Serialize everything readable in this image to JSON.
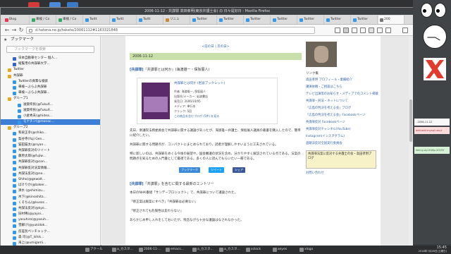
{
  "window": {
    "title": "2006-11-12 - 共謀罪 高田孝明(東京弁護士会) の 日々是好日 - Mozilla Firefox"
  },
  "tabs": [
    {
      "label": "Blog",
      "color": "#e35"
    },
    {
      "label": "車検 / Co",
      "color": "#3a6"
    },
    {
      "label": "車検 / Co",
      "color": "#3a6"
    },
    {
      "label": "Twitt",
      "color": "#39e"
    },
    {
      "label": "Twitt",
      "color": "#39e"
    },
    {
      "label": "Twitt",
      "color": "#39e"
    },
    {
      "label": "リニュ",
      "color": "#c83"
    },
    {
      "label": "Twitter",
      "color": "#39e"
    },
    {
      "label": "Twitter",
      "color": "#39e"
    },
    {
      "label": "Twitter",
      "color": "#39e"
    },
    {
      "label": "Twitter",
      "color": "#39e"
    },
    {
      "label": "Twitter",
      "color": "#39e"
    },
    {
      "label": "Twitter",
      "color": "#39e"
    },
    {
      "label": "Twitter",
      "color": "#39e"
    },
    {
      "label": "200",
      "color": "#777"
    }
  ],
  "nav": {
    "url": "d.hatena.ne.jp/takata/20061112#1163321848"
  },
  "sidebar": {
    "header": "ブックマーク",
    "search_placeholder": "ブックマークを検索",
    "items": [
      {
        "label": "日本自動車センター 個人...",
        "indent": 1,
        "color": "#36c"
      },
      {
        "label": "縦覧用の共謀罪大学...",
        "indent": 1,
        "color": "#36c"
      },
      {
        "label": "Twitter",
        "indent": 0,
        "color": "#e9a820"
      },
      {
        "label": "共謀罪",
        "indent": 0,
        "color": "#e9a820"
      },
      {
        "label": "Twitterの真摯な検索",
        "indent": 1,
        "color": "#39e"
      },
      {
        "label": "車検ーぶらぶ共謀罪",
        "indent": 1,
        "color": "#39e"
      },
      {
        "label": "車検ーぶらぶ共謀罪...",
        "indent": 1,
        "color": "#39e"
      },
      {
        "label": "グループ1",
        "indent": 0,
        "color": "#e9a820"
      },
      {
        "label": "滋賀県民(@FukuX...",
        "indent": 2,
        "color": "#39e"
      },
      {
        "label": "滋賀県民(@FukuX...",
        "indent": 2,
        "color": "#39e"
      },
      {
        "label": "小倉秀夫(@hidea...",
        "indent": 2,
        "color": "#39e"
      },
      {
        "label": "モナチン(@monac...",
        "indent": 2,
        "color": "#39e",
        "selected": true
      },
      {
        "label": "グループ2",
        "indent": 0,
        "color": "#e9a820"
      },
      {
        "label": "和泉正幸(@shiko...",
        "indent": 1,
        "color": "#39e"
      },
      {
        "label": "梨谷寺(Yuji Gen...",
        "indent": 1,
        "color": "#39e"
      },
      {
        "label": "猫田猫太(@nyan...",
        "indent": 1,
        "color": "#39e"
      },
      {
        "label": "共謀罪反対のツイート",
        "indent": 1,
        "color": "#39e"
      },
      {
        "label": "藤原太郎(@fujiw...",
        "indent": 1,
        "color": "#39e"
      },
      {
        "label": "共謀罪反対(@con...",
        "indent": 1,
        "color": "#39e"
      },
      {
        "label": "共謀罪反対法案情報...",
        "indent": 1,
        "color": "#39e"
      },
      {
        "label": "共謀法反対(@no...",
        "indent": 1,
        "color": "#39e"
      },
      {
        "label": "Shiho(@gewalt...",
        "indent": 1,
        "color": "#39e"
      },
      {
        "label": "ばけりか(@baker...",
        "indent": 1,
        "color": "#39e"
      },
      {
        "label": "清水 (@shimizu...",
        "indent": 1,
        "color": "#39e"
      },
      {
        "label": "木下(@kinoshita...",
        "indent": 1,
        "color": "#39e"
      },
      {
        "label": "くそちん(@kusoc...",
        "indent": 1,
        "color": "#39e"
      },
      {
        "label": "共謀法反対(@kyo...",
        "indent": 1,
        "color": "#39e"
      },
      {
        "label": "旧村鳴(@yayoi...",
        "indent": 1,
        "color": "#39e"
      },
      {
        "label": "yasuhiro(@yasuh...",
        "indent": 1,
        "color": "#39e"
      },
      {
        "label": "雪解け(@yukidok...",
        "indent": 1,
        "color": "#39e"
      },
      {
        "label": "反差別ペンチェック...",
        "indent": 1,
        "color": "#39e"
      },
      {
        "label": "森 司(@T_Ishik...",
        "indent": 1,
        "color": "#39e"
      },
      {
        "label": "海上(@umigami...",
        "indent": 1,
        "color": "#39e"
      },
      {
        "label": "jMatchiWho(@...",
        "indent": 1,
        "color": "#39e"
      },
      {
        "label": "共謀法反対(@pi...",
        "indent": 1,
        "color": "#39e"
      },
      {
        "label": "井上雄利(@inoue...",
        "indent": 1,
        "color": "#39e"
      }
    ]
  },
  "blog": {
    "pagenav": "<前の日 | 次の日>",
    "date": "2006-11-12",
    "entry_title_link": "[共謀罪]",
    "entry_title": "『共謀罪とは何か』(海渡雄一・保坂展人)",
    "book": {
      "title": "共謀罪とは何か (岩波ブックレット)",
      "lines": [
        "作者: 海渡雄一, 保坂展人",
        "出版社/メーカー: 岩波書店",
        "発売日: 2006/10/05",
        "メディア: 単行本",
        "クリック: 5回",
        "この商品を含むブログ (5件) を見る"
      ]
    },
    "paragraphs": [
      "先日、衆議院法務委員会で共謀罪に関する議論があったが、海渡雄一弁護士、保坂展人議員の著書を購入したので、簡単に紹介したい。",
      "共謀罪に関する問題点が、コンパクトにまとめられており、読者が理解しやすいように工夫されている。",
      "特に新しいのは、共謀罪をめぐる今後の展望や、国会審議の状況を含め、分かりやすく解説されている点である。法案の問題点を知るための入門書として最適である。多くの人に読んでもらいたい一冊である。"
    ],
    "share": [
      "ブックマーク",
      "ツイート",
      "シェア"
    ],
    "entry2_title_link": "[共謀罪]",
    "entry2_title": "「共謀罪」を含むに関する最新のエントリー",
    "paragraphs2": [
      "本日のNHK番組「サンデープロジェクト」で、共謀罪について議論された。",
      "「修正案は廃案にすべき」「共謀罪は必要ない」",
      "「修正されても危険性は変わらない」",
      "あらかじめ申し入れをしておいたが、残念ながら十分な議論はなされなかった。"
    ]
  },
  "side": {
    "section_title": "リンク集",
    "links": [
      "高田孝明 プロフィール・業績紹介",
      "講演依頼・ご相談はこちら",
      "テレビ出演等のお知らせ・メディアでのコメント掲載",
      "共謀罪・刑法・ネットについて",
      "「広島の判決を考える会」ブログ",
      "「広島の判決を考える会」Facebookページ",
      "共謀罪反対 Facebookページ",
      "共謀罪反対チャンネル(YouTube)",
      "Instagram(インスタグラム)",
      "盗聴法反対全国実行委員会"
    ],
    "banner": "共謀罪法案に反対する弁護士の会・高田孝明ブログ",
    "extra_link": "お問い合わせ"
  },
  "desktop_memos": [
    {
      "text": "- 2006-11-12",
      "bg": "#f8f8f8",
      "color": "#333"
    },
    {
      "text": "add-add-mysql-usq-t",
      "bg": "#fbdcdc",
      "color": "#a33"
    },
    {
      "text": "kenny-ay2018p-2019Y",
      "bg": "#d8f0d8",
      "color": "#363"
    }
  ],
  "taskbar": {
    "tasks": [
      {
        "label": "アクール"
      },
      {
        "label": "a_カスタ..."
      },
      {
        "label": "2006-11-..."
      },
      {
        "label": "emacs..."
      },
      {
        "label": "a_カスタ..."
      },
      {
        "label": "a_カスタ..."
      },
      {
        "label": "xclock"
      },
      {
        "label": "xeyes"
      },
      {
        "label": "xlogo"
      }
    ],
    "clock": "15:45",
    "date": "2018年7月28日(土曜日)"
  }
}
